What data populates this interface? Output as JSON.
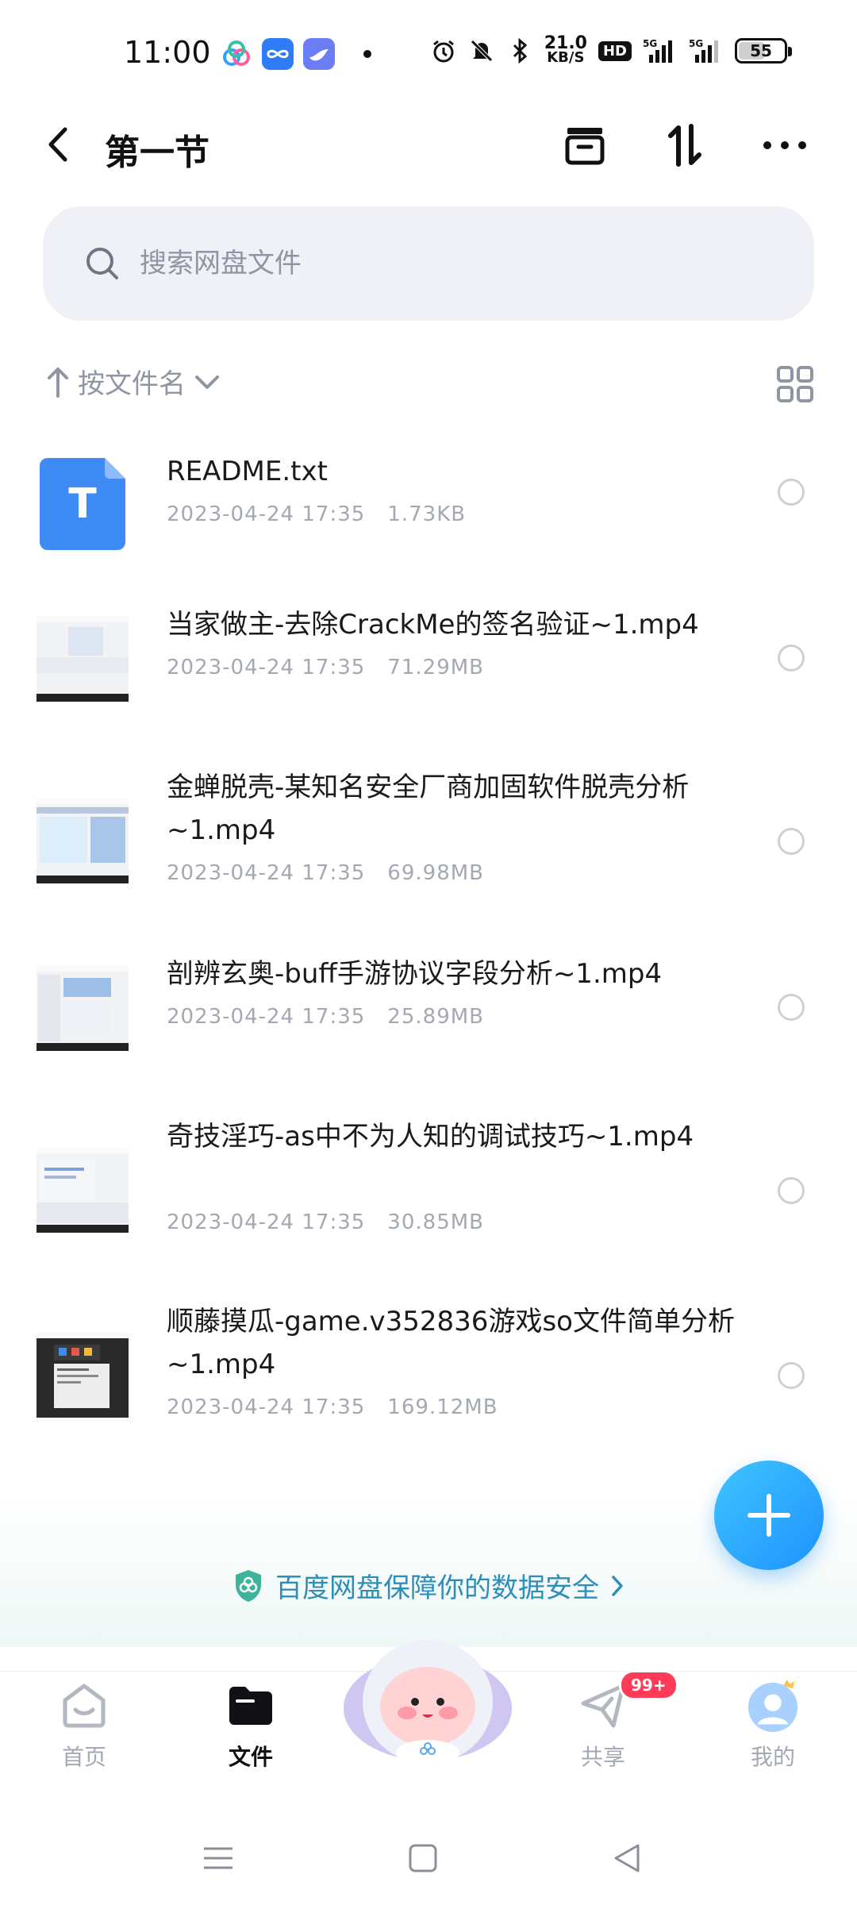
{
  "status_bar": {
    "time": "11:00",
    "net_speed_value": "21.0",
    "net_speed_unit": "KB/S",
    "hd": "HD",
    "signal1": "5G",
    "signal2": "5G",
    "battery": "55"
  },
  "header": {
    "title": "第一节"
  },
  "search": {
    "placeholder": "搜索网盘文件"
  },
  "sort": {
    "label": "按文件名"
  },
  "files": [
    {
      "name": "README.txt",
      "date": "2023-04-24 17:35",
      "size": "1.73KB",
      "type": "txt",
      "icon_letter": "T"
    },
    {
      "name": "当家做主-去除CrackMe的签名验证~1.mp4",
      "date": "2023-04-24 17:35",
      "size": "71.29MB",
      "type": "video"
    },
    {
      "name": "金蝉脱壳-某知名安全厂商加固软件脱壳分析~1.mp4",
      "date": "2023-04-24 17:35",
      "size": "69.98MB",
      "type": "video"
    },
    {
      "name": "剖辨玄奥-buff手游协议字段分析~1.mp4",
      "date": "2023-04-24 17:35",
      "size": "25.89MB",
      "type": "video"
    },
    {
      "name": "奇技淫巧-as中不为人知的调试技巧~1.mp4",
      "date": "2023-04-24 17:35",
      "size": "30.85MB",
      "type": "video"
    },
    {
      "name": "顺藤摸瓜-game.v352836游戏so文件简单分析~1.mp4",
      "date": "2023-04-24 17:35",
      "size": "169.12MB",
      "type": "video"
    }
  ],
  "security_banner": {
    "text": "百度网盘保障你的数据安全"
  },
  "bottom_nav": {
    "home": "首页",
    "files": "文件",
    "share": "共享",
    "share_badge": "99+",
    "mine": "我的"
  },
  "colors": {
    "accent": "#1e92ff",
    "security_text": "#2d8fb9",
    "badge": "#ff3b57"
  }
}
